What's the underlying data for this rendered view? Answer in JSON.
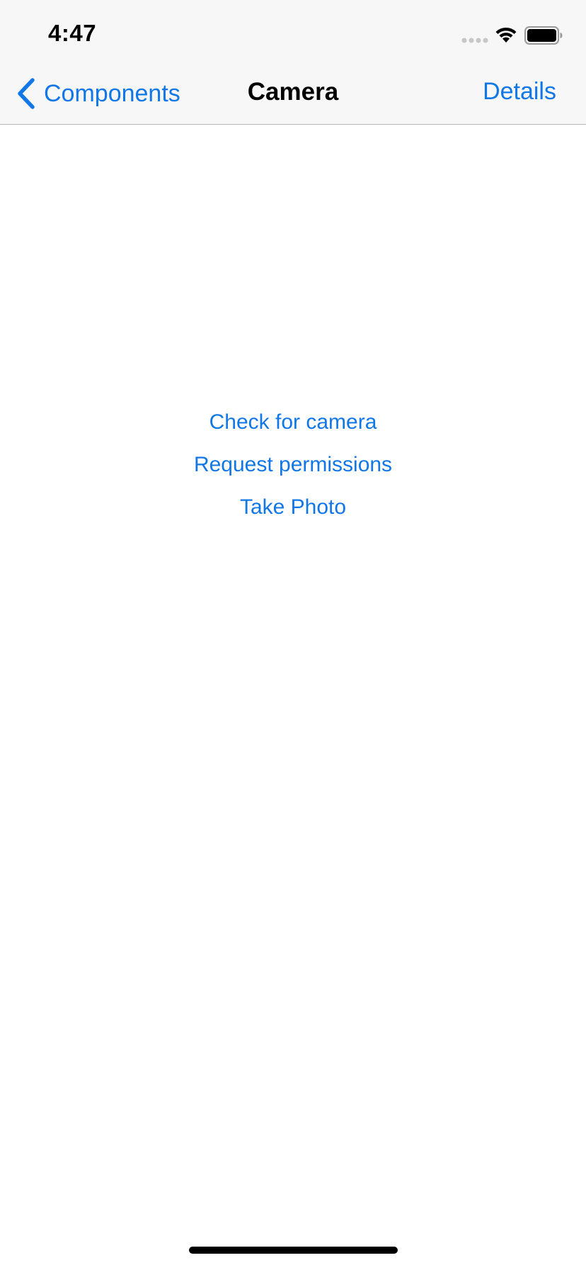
{
  "status_bar": {
    "time": "4:47",
    "icons": [
      "signal-icon",
      "wifi-icon",
      "battery-icon"
    ]
  },
  "nav": {
    "back_label": "Components",
    "title": "Camera",
    "details_label": "Details",
    "back_icon": "chevron-left-icon"
  },
  "actions": {
    "check_camera": "Check for camera",
    "request_permissions": "Request permissions",
    "take_photo": "Take Photo"
  },
  "colors": {
    "accent": "#1277e6",
    "nav_background": "#f7f7f7",
    "page_background": "#ffffff"
  }
}
